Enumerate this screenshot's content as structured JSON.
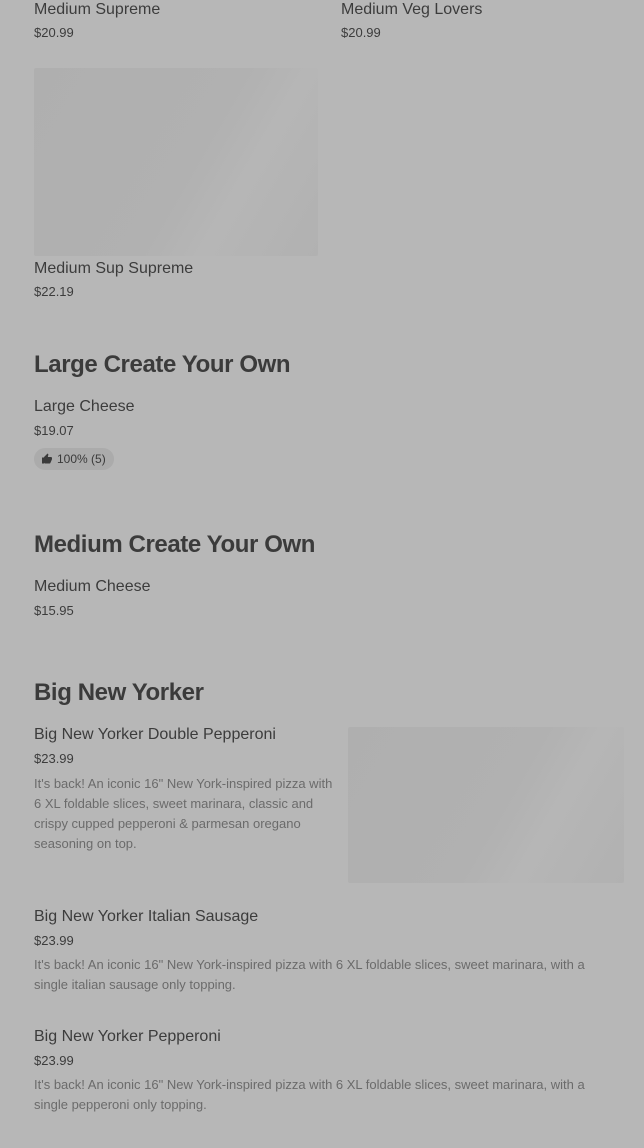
{
  "top_grid": [
    {
      "name": "Medium Supreme",
      "price": "$20.99"
    },
    {
      "name": "Medium Veg Lovers",
      "price": "$20.99"
    },
    {
      "name": "Medium Sup Supreme",
      "price": "$22.19"
    }
  ],
  "sections": [
    {
      "title": "Large Create Your Own",
      "items": [
        {
          "name": "Large Cheese",
          "price": "$19.07",
          "rating": "100% (5)",
          "rating_icon": "thumbs-up-icon"
        }
      ]
    },
    {
      "title": "Medium Create Your Own",
      "items": [
        {
          "name": "Medium Cheese",
          "price": "$15.95"
        }
      ]
    },
    {
      "title": "Big New Yorker",
      "items": [
        {
          "name": "Big New Yorker Double Pepperoni",
          "price": "$23.99",
          "description": "It's back! An iconic 16\" New York-inspired pizza with 6 XL foldable slices, sweet marinara, classic and crispy cupped pepperoni & parmesan oregano seasoning on top."
        },
        {
          "name": "Big New Yorker Italian Sausage",
          "price": "$23.99",
          "description": "It's back! An iconic 16\" New York-inspired pizza with 6 XL foldable slices, sweet marinara, with a single italian sausage only topping."
        },
        {
          "name": "Big New Yorker Pepperoni",
          "price": "$23.99",
          "description": "It's back! An iconic 16\" New York-inspired pizza with 6 XL foldable slices, sweet marinara, with a single pepperoni only topping."
        }
      ]
    }
  ],
  "colors": {
    "overlay_background": "#b7b7b7",
    "text_primary": "#3c3c3c",
    "text_secondary": "#6b6b6b"
  }
}
